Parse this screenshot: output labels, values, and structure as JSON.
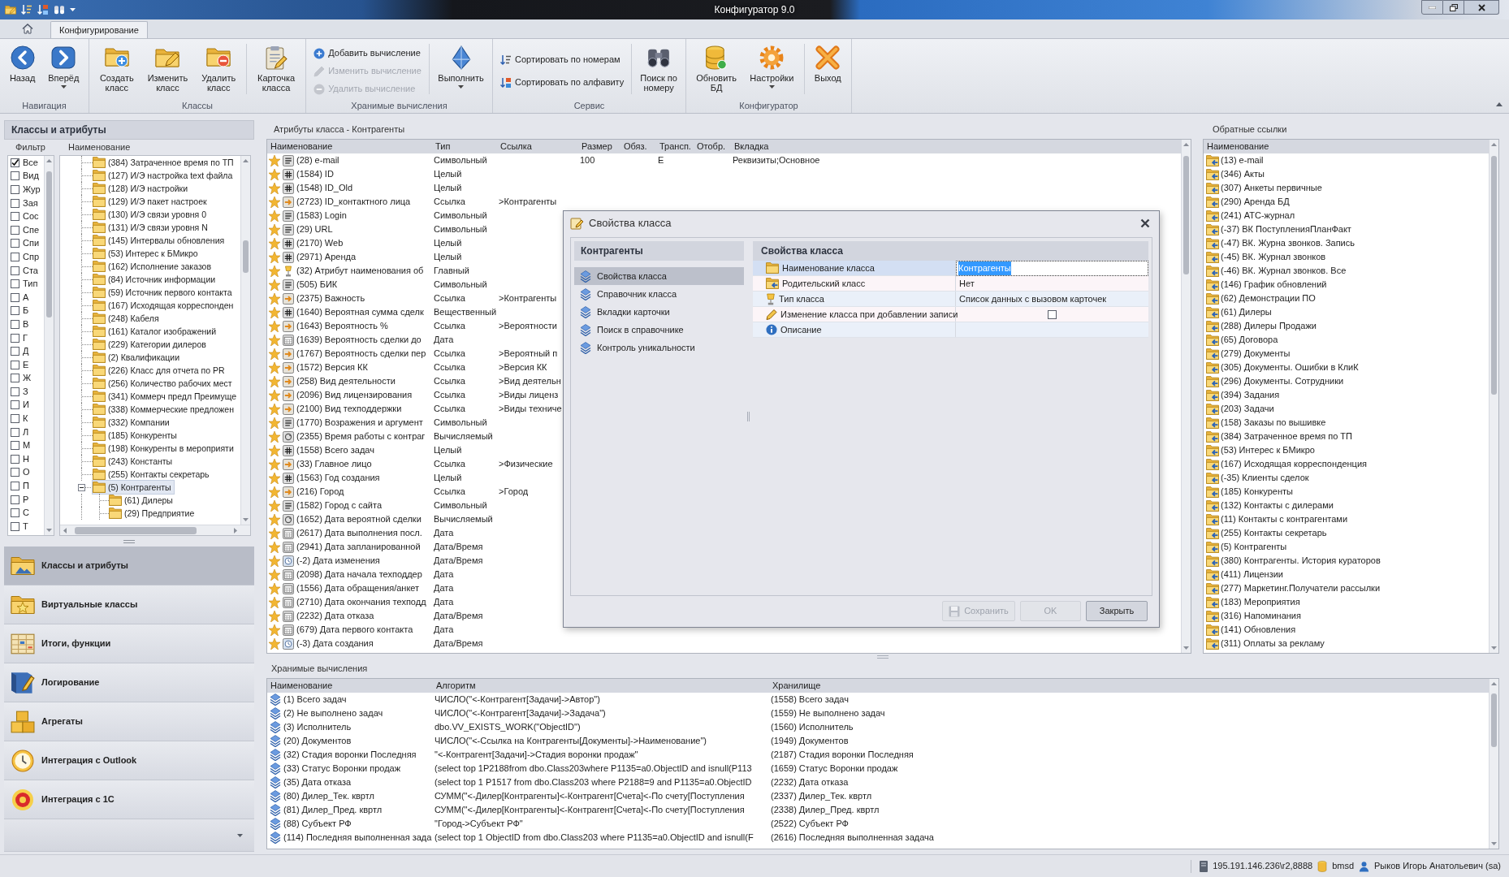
{
  "window": {
    "title": "Конфигуратор 9.0"
  },
  "ribbon": {
    "tabs": [
      {
        "label": "Конфигурирование",
        "selected": true
      }
    ],
    "groups": [
      {
        "label": "Навигация",
        "buttons": [
          {
            "kind": "large",
            "label": "Назад",
            "menu": false
          },
          {
            "kind": "large",
            "label": "Вперёд",
            "menu": true
          }
        ]
      },
      {
        "label": "Классы",
        "buttons": [
          {
            "kind": "large",
            "label": "Создать\nкласс",
            "menu": false
          },
          {
            "kind": "large",
            "label": "Изменить\nкласс",
            "menu": false
          },
          {
            "kind": "large",
            "label": "Удалить\nкласс",
            "menu": false
          },
          {
            "kind": "separator"
          },
          {
            "kind": "large",
            "label": "Карточка\nкласса",
            "menu": false
          }
        ]
      },
      {
        "label": "Хранимые вычисления",
        "buttons": [
          {
            "kind": "stack",
            "items": [
              {
                "label": "Добавить вычисление",
                "disabled": false
              },
              {
                "label": "Изменить вычисление",
                "disabled": true
              },
              {
                "label": "Удалить вычисление",
                "disabled": true
              }
            ]
          },
          {
            "kind": "separator"
          },
          {
            "kind": "large",
            "label": "Выполнить",
            "menu": true
          }
        ]
      },
      {
        "label": "Сервис",
        "buttons": [
          {
            "kind": "stack",
            "items": [
              {
                "label": "Сортировать по номерам",
                "disabled": false
              },
              {
                "label": "Сортировать по алфавиту",
                "disabled": false
              }
            ]
          },
          {
            "kind": "separator"
          },
          {
            "kind": "large",
            "label": "Поиск по\nномеру",
            "menu": false
          }
        ]
      },
      {
        "label": "Конфигуратор",
        "buttons": [
          {
            "kind": "large",
            "label": "Обновить\nБД",
            "menu": false
          },
          {
            "kind": "large",
            "label": "Настройки",
            "menu": true
          },
          {
            "kind": "separator"
          },
          {
            "kind": "large",
            "label": "Выход",
            "menu": false
          }
        ]
      }
    ]
  },
  "left_panel": {
    "title": "Классы и атрибуты",
    "columns": [
      "Фильтр",
      "Наименование"
    ],
    "filter": [
      {
        "label": "Все",
        "checked": true
      },
      {
        "label": "Вид",
        "checked": false
      },
      {
        "label": "Жур",
        "checked": false
      },
      {
        "label": "Зая",
        "checked": false
      },
      {
        "label": "Сос",
        "checked": false
      },
      {
        "label": "Спе",
        "checked": false
      },
      {
        "label": "Спи",
        "checked": false
      },
      {
        "label": "Спр",
        "checked": false
      },
      {
        "label": "Ста",
        "checked": false
      },
      {
        "label": "Тип",
        "checked": false
      },
      {
        "label": "А",
        "checked": false
      },
      {
        "label": "Б",
        "checked": false
      },
      {
        "label": "В",
        "checked": false
      },
      {
        "label": "Г",
        "checked": false
      },
      {
        "label": "Д",
        "checked": false
      },
      {
        "label": "Е",
        "checked": false
      },
      {
        "label": "Ж",
        "checked": false
      },
      {
        "label": "З",
        "checked": false
      },
      {
        "label": "И",
        "checked": false
      },
      {
        "label": "К",
        "checked": false
      },
      {
        "label": "Л",
        "checked": false
      },
      {
        "label": "М",
        "checked": false
      },
      {
        "label": "Н",
        "checked": false
      },
      {
        "label": "О",
        "checked": false
      },
      {
        "label": "П",
        "checked": false
      },
      {
        "label": "Р",
        "checked": false
      },
      {
        "label": "С",
        "checked": false
      },
      {
        "label": "Т",
        "checked": false
      }
    ],
    "tree": [
      {
        "label": "(384) Затраченное время по ТП",
        "selected": false
      },
      {
        "label": "(127) И/Э настройка text файла",
        "selected": false
      },
      {
        "label": "(128) И/Э настройки",
        "selected": false
      },
      {
        "label": "(129) И/Э пакет настроек",
        "selected": false
      },
      {
        "label": "(130) И/Э связи уровня 0",
        "selected": false
      },
      {
        "label": "(131) И/Э связи уровня N",
        "selected": false
      },
      {
        "label": "(145) Интервалы обновления",
        "selected": false
      },
      {
        "label": "(53) Интерес к БМикро",
        "selected": false
      },
      {
        "label": "(162) Исполнение заказов",
        "selected": false
      },
      {
        "label": "(84) Источник информации",
        "selected": false
      },
      {
        "label": "(59) Источник первого контакта",
        "selected": false
      },
      {
        "label": "(167) Исходящая корреспонден",
        "selected": false
      },
      {
        "label": "(248) Кабеля",
        "selected": false
      },
      {
        "label": "(161) Каталог изображений",
        "selected": false
      },
      {
        "label": "(229) Категории дилеров",
        "selected": false
      },
      {
        "label": "(2) Квалификации",
        "selected": false
      },
      {
        "label": "(226) Класс для отчета по PR",
        "selected": false
      },
      {
        "label": "(256) Количество рабочих мест",
        "selected": false
      },
      {
        "label": "(341) Коммерч предл Преимуще",
        "selected": false
      },
      {
        "label": "(338) Коммерческие предложен",
        "selected": false
      },
      {
        "label": "(332) Компании",
        "selected": false
      },
      {
        "label": "(185) Конкуренты",
        "selected": false
      },
      {
        "label": "(198) Конкуренты в мероприяти",
        "selected": false
      },
      {
        "label": "(243) Константы",
        "selected": false
      },
      {
        "label": "(255) Контакты секретарь",
        "selected": false
      },
      {
        "label": "(5) Контрагенты",
        "selected": true,
        "expanded": true,
        "children": [
          {
            "label": "(61) Дилеры",
            "selected": false
          },
          {
            "label": "(29) Предприятие",
            "selected": false
          }
        ]
      }
    ]
  },
  "nav": [
    {
      "label": "Классы и атрибуты",
      "selected": true
    },
    {
      "label": "Виртуальные классы",
      "selected": false
    },
    {
      "label": "Итоги, функции",
      "selected": false
    },
    {
      "label": "Логирование",
      "selected": false
    },
    {
      "label": "Агрегаты",
      "selected": false
    },
    {
      "label": "Интеграция с Outlook",
      "selected": false
    },
    {
      "label": "Интеграция с 1С",
      "selected": false
    }
  ],
  "attributes": {
    "title": "Атрибуты класса - Контрагенты",
    "columns": [
      "Наименование",
      "Тип",
      "Ссылка",
      "Размер",
      "Обяз.",
      "Трансп.",
      "Отобр.",
      "Вкладка"
    ],
    "rows": [
      {
        "kind": "text",
        "name": "(28) e-mail",
        "type": "Символьный",
        "size": "100",
        "transp": "Е",
        "tab": "Реквизиты;Основное"
      },
      {
        "kind": "integer",
        "name": "(1584) ID",
        "type": "Целый"
      },
      {
        "kind": "integer",
        "name": "(1548) ID_Old",
        "type": "Целый"
      },
      {
        "kind": "link",
        "name": "(2723) ID_контактного лица",
        "type": "Ссылка",
        "link": ">Контрагенты"
      },
      {
        "kind": "text",
        "name": "(1583) Login",
        "type": "Символьный"
      },
      {
        "kind": "text",
        "name": "(29) URL",
        "type": "Символьный"
      },
      {
        "kind": "integer",
        "name": "(2170) Web",
        "type": "Целый"
      },
      {
        "kind": "integer",
        "name": "(2971) Аренда",
        "type": "Целый"
      },
      {
        "kind": "main",
        "name": "(32) Атрибут наименования об",
        "type": "Главный"
      },
      {
        "kind": "text",
        "name": "(505) БИК",
        "type": "Символьный"
      },
      {
        "kind": "link",
        "name": "(2375) Важность",
        "type": "Ссылка",
        "link": ">Контрагенты"
      },
      {
        "kind": "integer",
        "name": "(1640) Вероятная сумма сделк",
        "type": "Вещественный"
      },
      {
        "kind": "link",
        "name": "(1643) Вероятность %",
        "type": "Ссылка",
        "link": ">Вероятности"
      },
      {
        "kind": "date",
        "name": "(1639) Вероятность сделки до",
        "type": "Дата"
      },
      {
        "kind": "link",
        "name": "(1767) Вероятность сделки пер",
        "type": "Ссылка",
        "link": ">Вероятный п"
      },
      {
        "kind": "link",
        "name": "(1572) Версия КК",
        "type": "Ссылка",
        "link": ">Версия КК"
      },
      {
        "kind": "link",
        "name": "(258) Вид деятельности",
        "type": "Ссылка",
        "link": ">Вид деятельн"
      },
      {
        "kind": "link",
        "name": "(2096) Вид лицензирования",
        "type": "Ссылка",
        "link": ">Виды лиценз"
      },
      {
        "kind": "link",
        "name": "(2100) Вид техподдержки",
        "type": "Ссылка",
        "link": ">Виды техниче"
      },
      {
        "kind": "text",
        "name": "(1770) Возражения и аргумент",
        "type": "Символьный"
      },
      {
        "kind": "calc",
        "name": "(2355) Время работы с контраг",
        "type": "Вычисляемый"
      },
      {
        "kind": "integer",
        "name": "(1558) Всего задач",
        "type": "Целый"
      },
      {
        "kind": "link",
        "name": "(33) Главное лицо",
        "type": "Ссылка",
        "link": ">Физические"
      },
      {
        "kind": "integer",
        "name": "(1563) Год создания",
        "type": "Целый"
      },
      {
        "kind": "link",
        "name": "(216) Город",
        "type": "Ссылка",
        "link": ">Город"
      },
      {
        "kind": "text",
        "name": "(1582) Город с сайта",
        "type": "Символьный"
      },
      {
        "kind": "calc",
        "name": "(1652) Дата вероятной сделки",
        "type": "Вычисляемый"
      },
      {
        "kind": "date",
        "name": "(2617) Дата выполнения посл.",
        "type": "Дата"
      },
      {
        "kind": "date",
        "name": "(2941) Дата запланированной",
        "type": "Дата/Время"
      },
      {
        "kind": "system",
        "name": "(-2) Дата изменения",
        "type": "Дата/Время"
      },
      {
        "kind": "date",
        "name": "(2098) Дата начала техподдер",
        "type": "Дата"
      },
      {
        "kind": "date",
        "name": "(1556) Дата обращения/анкет",
        "type": "Дата"
      },
      {
        "kind": "date",
        "name": "(2710) Дата окончания техподд",
        "type": "Дата"
      },
      {
        "kind": "date",
        "name": "(2232) Дата отказа",
        "type": "Дата/Время"
      },
      {
        "kind": "date",
        "name": "(679) Дата первого контакта",
        "type": "Дата"
      },
      {
        "kind": "system",
        "name": "(-3) Дата создания",
        "type": "Дата/Время"
      }
    ]
  },
  "backlinks": {
    "title": "Обратные ссылки",
    "columns": [
      "Наименование"
    ],
    "items": [
      "(13) e-mail",
      "(346) Акты",
      "(307) Анкеты первичные",
      "(290) Аренда БД",
      "(241) АТС-журнал",
      "(-37) ВК ПоступленияПланФакт",
      "(-47) ВК. Журна звонков. Запись",
      "(-45) ВК. Журнал звонков",
      "(-46) ВК. Журнал звонков. Все",
      "(146) График обновлений",
      "(62) Демонстрации ПО",
      "(61) Дилеры",
      "(288) Дилеры Продажи",
      "(65) Договора",
      "(279) Документы",
      "(305) Документы. Ошибки в КлиК",
      "(296) Документы. Сотрудники",
      "(394) Задания",
      "(203) Задачи",
      "(158) Заказы по вышивке",
      "(384) Затраченное время по ТП",
      "(53) Интерес к БМикро",
      "(167) Исходящая корреспонденция",
      "(-35) Клиенты сделок",
      "(185) Конкуренты",
      "(132) Контакты с дилерами",
      "(11) Контакты с контрагентами",
      "(255) Контакты секретарь",
      "(5) Контрагенты",
      "(380) Контрагенты. История кураторов",
      "(411) Лицензии",
      "(277) Маркетинг.Получатели рассылки",
      "(183) Мероприятия",
      "(316) Напоминания",
      "(141) Обновления",
      "(311) Оплаты за рекламу"
    ]
  },
  "dialog": {
    "title": "Свойства класса",
    "nav": {
      "title": "Контрагенты",
      "items": [
        {
          "label": "Свойства класса",
          "selected": true
        },
        {
          "label": "Справочник класса",
          "selected": false
        },
        {
          "label": "Вкладки карточки",
          "selected": false
        },
        {
          "label": "Поиск в справочнике",
          "selected": false
        },
        {
          "label": "Контроль уникальности",
          "selected": false
        }
      ]
    },
    "properties": {
      "title": "Свойства класса",
      "rows": [
        {
          "kind": "text",
          "label": "Наименование класса",
          "value": "Контрагенты",
          "selected": true
        },
        {
          "kind": "text",
          "label": "Родительский класс",
          "value": "Нет",
          "selected": false
        },
        {
          "kind": "text",
          "label": "Тип класса",
          "value": "Список данных с вызовом карточек",
          "selected": false
        },
        {
          "kind": "checkbox",
          "label": "Изменение класса при добавлении записи",
          "checked": false,
          "selected": false
        },
        {
          "kind": "text",
          "label": "Описание",
          "selected": false
        }
      ]
    },
    "buttons": [
      {
        "label": "Сохранить",
        "disabled": true
      },
      {
        "label": "OK",
        "disabled": true
      },
      {
        "label": "Закрыть",
        "disabled": false
      }
    ]
  },
  "stored": {
    "title": "Хранимые вычисления",
    "columns": [
      "Наименование",
      "Алгоритм",
      "Хранилище"
    ],
    "rows": [
      {
        "name": "(1) Всего задач",
        "algorithm": "ЧИСЛО(\"<-Контрагент[Задачи]->Автор\")",
        "storage": "(1558) Всего задач"
      },
      {
        "name": "(2) Не выполнено задач",
        "algorithm": "ЧИСЛО(\"<-Контрагент[Задачи]->Задача\")",
        "storage": "(1559) Не выполнено задач"
      },
      {
        "name": "(3) Исполнитель",
        "algorithm": "dbo.VV_EXISTS_WORK(\"ObjectID\")",
        "storage": "(1560) Исполнитель"
      },
      {
        "name": "(20) Документов",
        "algorithm": "ЧИСЛО(\"<-Ссылка на Контрагенты[Документы]->Наименование\")",
        "storage": "(1949) Документов"
      },
      {
        "name": "(32) Стадия воронки Последняя",
        "algorithm": "\"<-Контрагент[Задачи]->Стадия воронки продаж\"",
        "storage": "(2187) Стадия воронки Последняя"
      },
      {
        "name": "(33) Статус Воронки продаж",
        "algorithm": "(select top 1P2188from dbo.Class203where P1135=a0.ObjectID and isnull(P113",
        "storage": "(1659) Статус Воронки продаж"
      },
      {
        "name": "(35) Дата отказа",
        "algorithm": "(select top 1 P1517 from dbo.Class203 where P2188=9 and P1135=a0.ObjectID",
        "storage": "(2232) Дата отказа"
      },
      {
        "name": "(80) Дилер_Тек. квртл",
        "algorithm": "СУММ(\"<-Дилер[Контрагенты]<-Контрагент[Счета]<-По счету[Поступления",
        "storage": "(2337) Дилер_Тек. квртл"
      },
      {
        "name": "(81) Дилер_Пред. квртл",
        "algorithm": "СУММ(\"<-Дилер[Контрагенты]<-Контрагент[Счета]<-По счету[Поступления",
        "storage": "(2338) Дилер_Пред. квртл"
      },
      {
        "name": "(88) Субъект РФ",
        "algorithm": "\"Город->Субъект РФ\"",
        "storage": "(2522) Субъект РФ"
      },
      {
        "name": "(114) Последняя выполненная зада",
        "algorithm": "(select top 1 ObjectID from dbo.Class203 where P1135=a0.ObjectID and isnull(F",
        "storage": "(2616) Последняя выполненная задача"
      }
    ]
  },
  "status_bar": {
    "server": "195.191.146.236\\r2,8888",
    "database": "bmsd",
    "user": "Рыков Игорь Анатольевич (sa)"
  }
}
